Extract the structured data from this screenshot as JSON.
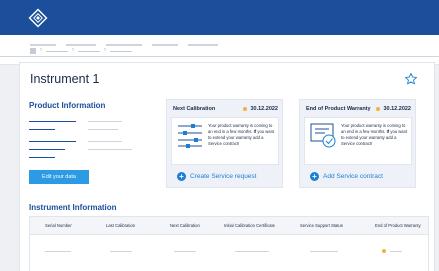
{
  "page": {
    "title": "Instrument 1"
  },
  "product_info": {
    "heading": "Product Information",
    "edit_button": "Edit your data"
  },
  "next_calibration": {
    "title": "Next Calibration",
    "date": "30.12.2022",
    "text_before": "Your product warranty is coming to an end in a few months. ",
    "text_bold": "If",
    "text_after": " you want to extend your warranty add a Service contract!",
    "link": "Create Service request",
    "icon": "calibration-sliders-icon"
  },
  "warranty": {
    "title": "End of Product Warranty",
    "date": "30.12.2022",
    "text_before": "Your product warranty is coming to an end in a few months. ",
    "text_bold": "If",
    "text_after": " you want to extend your warranty add a Service contract!",
    "link": "Add Service contract",
    "icon": "certificate-icon"
  },
  "instrument_info": {
    "heading": "Instrument Information",
    "columns": [
      "Serial Number",
      "Last Calibration",
      "Next Calibration",
      "Initial Calibration Certificate",
      "Service Support Status",
      "End of Product Warranty"
    ]
  },
  "colors": {
    "brand": "#1b4f9b",
    "accent": "#1b7fd6",
    "button": "#2c9be3",
    "status_dot": "#f0b43c"
  }
}
